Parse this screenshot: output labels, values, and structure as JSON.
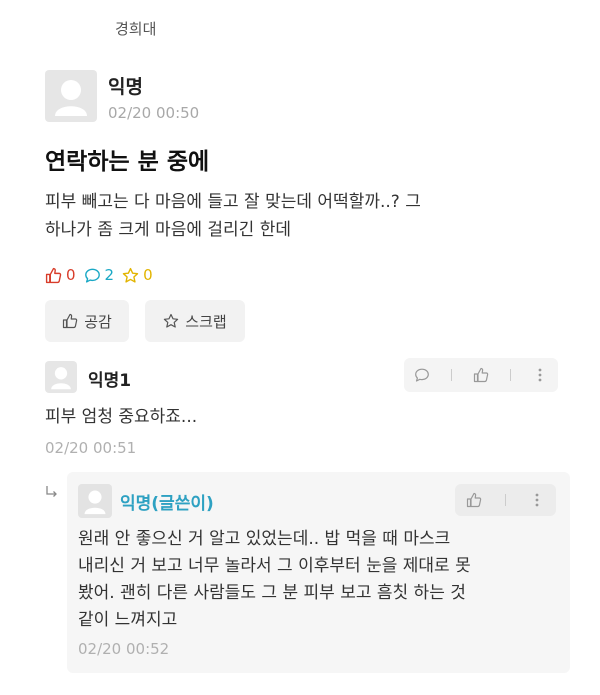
{
  "board": {
    "name": "경희대"
  },
  "post": {
    "author": "익명",
    "time": "02/20 00:50",
    "title": "연락하는 분 중에",
    "body_lines": [
      "피부 빼고는 다 마음에 들고 잘 맞는데 어떡할까..? 그",
      "하나가 좀 크게 마음에 걸리긴 한데"
    ],
    "stats": {
      "likes": "0",
      "comments": "2",
      "scraps": "0"
    },
    "buttons": {
      "like": "공감",
      "scrap": "스크랩"
    }
  },
  "comments": [
    {
      "author": "익명1",
      "body": "피부 엄청 중요하죠...",
      "time": "02/20 00:51"
    }
  ],
  "reply": {
    "author": "익명(글쓴이)",
    "body_lines": [
      "원래 안 좋으신 거 알고 있었는데.. 밥 먹을 때 마스크",
      "내리신 거 보고 너무 놀라서 그 이후부터 눈을 제대로 못",
      "봤어. 괜히 다른 사람들도 그 분 피부 보고 흠칫 하는 것",
      "같이 느껴지고"
    ],
    "time": "02/20 00:52"
  },
  "colors": {
    "like": "#d83c2a",
    "comment": "#1aa8c5",
    "scrap": "#e2b400",
    "op_author": "#2ea1c2"
  },
  "icons": [
    "thumbs-up-icon",
    "speech-bubble-icon",
    "star-icon",
    "more-vertical-icon",
    "reply-arrow-icon",
    "default-avatar-icon"
  ]
}
